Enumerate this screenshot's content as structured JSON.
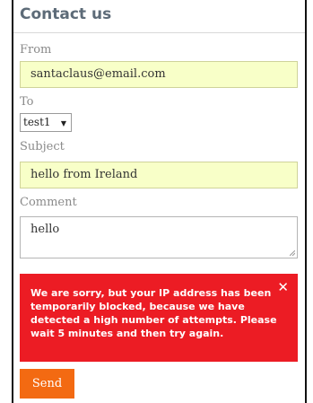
{
  "form": {
    "title": "Contact us",
    "from_label": "From",
    "from_value": "santaclaus@email.com",
    "to_label": "To",
    "to_selected": "test1",
    "subject_label": "Subject",
    "subject_value": "hello from Ireland",
    "comment_label": "Comment",
    "comment_value": "hello",
    "send_label": "Send"
  },
  "alert": {
    "message": "We are sorry, but your IP address has been temporarily blocked, because we have detected a high number of attempts. Please wait 5 minutes and then try again.",
    "close_glyph": "✕"
  },
  "colors": {
    "input_bg": "#f8ffc8",
    "alert_bg": "#ec1c24",
    "send_button": "#f36a12",
    "title": "#5d6b78"
  }
}
